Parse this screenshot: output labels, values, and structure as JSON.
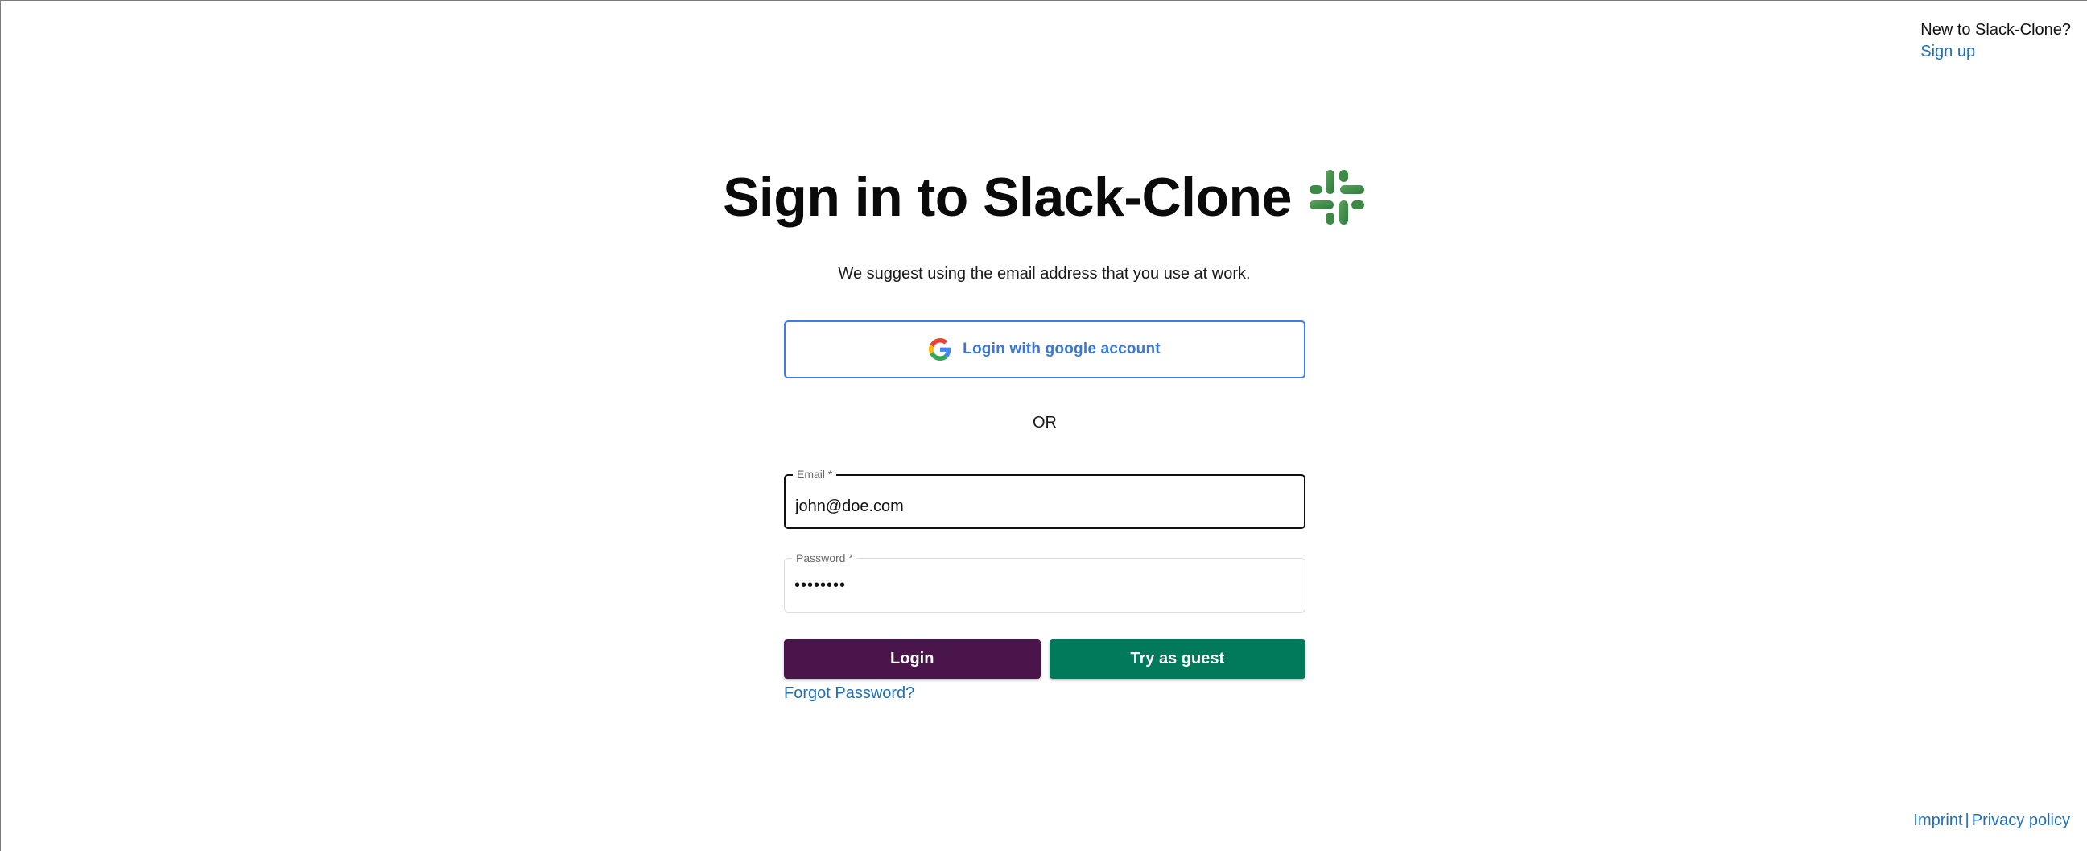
{
  "header": {
    "signup_question": "New to Slack-Clone?",
    "signup_link": "Sign up"
  },
  "main": {
    "title": "Sign in to Slack-Clone",
    "subtitle": "We suggest using the email address that you use at work.",
    "google_button_label": "Login with google account",
    "divider_text": "OR",
    "email": {
      "label": "Email *",
      "value": "john@doe.com"
    },
    "password": {
      "label": "Password *",
      "value": "••••••••"
    },
    "login_button": "Login",
    "guest_button": "Try as guest",
    "forgot_password": "Forgot Password?"
  },
  "footer": {
    "imprint": "Imprint",
    "separator": "|",
    "privacy": "Privacy policy"
  },
  "colors": {
    "login_button": "#4a154b",
    "guest_button": "#007a5a",
    "google_border": "#3b7de9",
    "link": "#1e6fb5"
  },
  "icons": {
    "logo": "slack-logo-icon",
    "google": "google-icon"
  }
}
